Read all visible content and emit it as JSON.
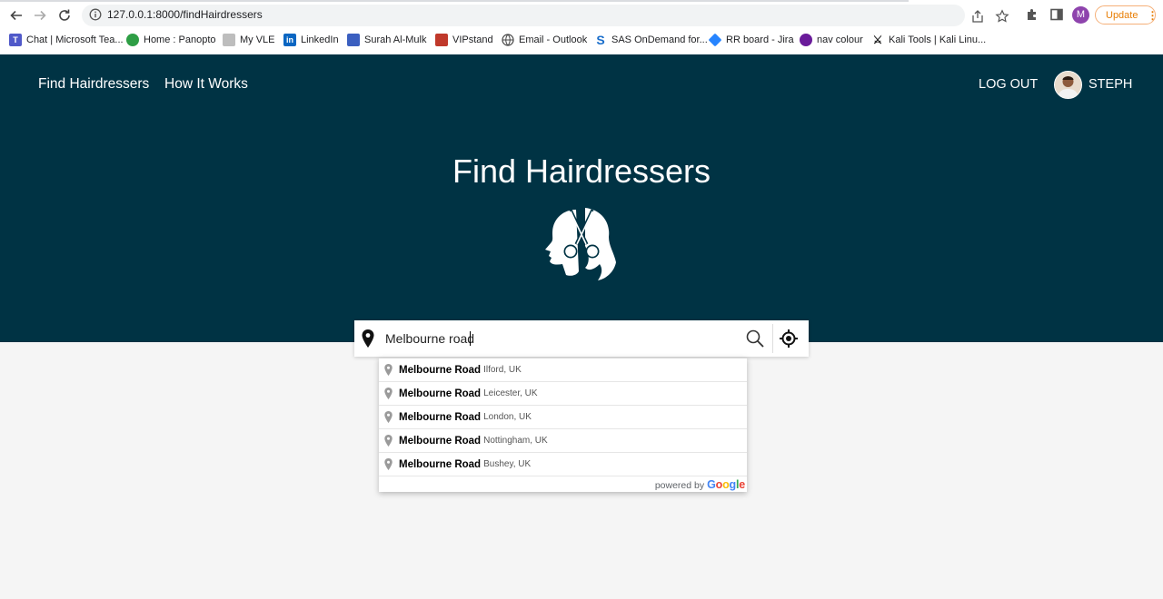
{
  "browser": {
    "url": "127.0.0.1:8000/findHairdressers",
    "profile_initial": "M",
    "update_label": "Update",
    "bookmarks": [
      {
        "label": "Chat | Microsoft Tea...",
        "icon": "teams-icon",
        "color": "#5059c9"
      },
      {
        "label": "Home : Panopto",
        "icon": "panopto-icon",
        "color": "#2e9e45"
      },
      {
        "label": "My VLE",
        "icon": "vle-icon",
        "color": "#8a8a8a"
      },
      {
        "label": "LinkedIn",
        "icon": "linkedin-icon",
        "color": "#0a66c2"
      },
      {
        "label": "Surah Al-Mulk",
        "icon": "quran-icon",
        "color": "#3b5fc0"
      },
      {
        "label": "VIPstand",
        "icon": "vipstand-icon",
        "color": "#c0392b"
      },
      {
        "label": "Email - Outlook",
        "icon": "globe-icon",
        "color": "#444444"
      },
      {
        "label": "SAS OnDemand for...",
        "icon": "sas-icon",
        "color": "#1a6ecb"
      },
      {
        "label": "RR board - Jira",
        "icon": "jira-icon",
        "color": "#2684ff"
      },
      {
        "label": "nav colour",
        "icon": "nav-colour-icon",
        "color": "#6a1b9a"
      },
      {
        "label": "Kali Tools | Kali Linu...",
        "icon": "kali-icon",
        "color": "#222222"
      }
    ]
  },
  "site": {
    "nav": {
      "find": "Find Hairdressers",
      "how": "How It Works",
      "logout": "LOG OUT",
      "user": "STEPH"
    },
    "hero_title": "Find Hairdressers",
    "search": {
      "value": "Melbourne road",
      "placeholder": ""
    },
    "suggestions": [
      {
        "main": "Melbourne Road",
        "secondary": "Ilford, UK"
      },
      {
        "main": "Melbourne Road",
        "secondary": "Leicester, UK"
      },
      {
        "main": "Melbourne Road",
        "secondary": "London, UK"
      },
      {
        "main": "Melbourne Road",
        "secondary": "Nottingham, UK"
      },
      {
        "main": "Melbourne Road",
        "secondary": "Bushey, UK"
      }
    ],
    "powered_by": "powered by",
    "google": "Google"
  },
  "colors": {
    "hero": "#003344",
    "page_bg": "#f5f5f5",
    "update_accent": "#e87e04"
  }
}
